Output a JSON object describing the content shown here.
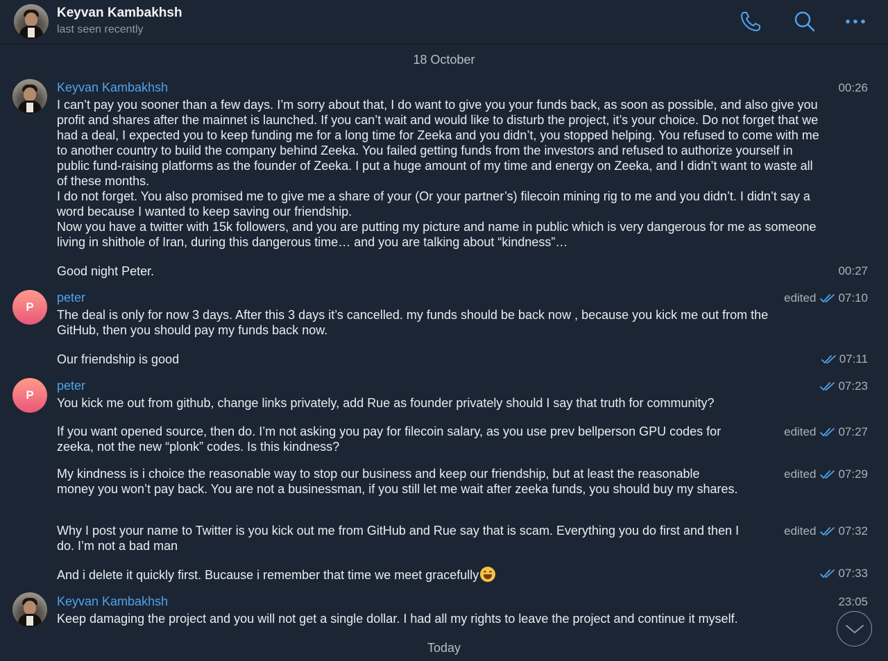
{
  "header": {
    "title": "Keyvan Kambakhsh",
    "subtitle": "last seen recently",
    "icons": [
      "phone-icon",
      "search-icon",
      "more-icon"
    ]
  },
  "colors": {
    "background": "#1c2533",
    "accent": "#4ea4f0",
    "text": "#e9edf2",
    "meta": "#a7b2be"
  },
  "dates": {
    "first": "18 October",
    "today": "Today"
  },
  "messages": [
    {
      "sender": "Keyvan Kambakhsh",
      "time": "00:26",
      "paragraphs": [
        "I can’t pay you sooner than a few days. I’m sorry about that, I do want to give you your funds back, as soon as possible, and also give you profit and shares after the mainnet is launched. If you can’t wait and would like to disturb the project, it’s your choice. Do not forget that we had a deal, I expected you to keep funding me for a long time for Zeeka and you didn’t, you stopped helping. You refused to come with me to another country to build the company behind Zeeka. You failed getting funds from the investors and refused to authorize yourself in public fund-raising platforms as the founder of Zeeka. I put a huge amount of my time and energy on Zeeka, and I didn’t want to waste all of these months.",
        "I do not forget. You also promised me to give me a share of your (Or your partner’s) filecoin mining rig to me and you didn’t. I didn’t say a word because I wanted to keep saving our friendship.",
        "Now you have a twitter with 15k followers, and you are putting my picture and name in public which is very dangerous for me as someone living in shithole of Iran, during this dangerous time… and you are talking about “kindness”…"
      ]
    },
    {
      "text": "Good night Peter.",
      "time": "00:27"
    },
    {
      "sender": "peter",
      "avatar_letter": "P",
      "edited": "edited",
      "time": "07:10",
      "text": "The deal is only for now 3 days.  After this 3 days it’s cancelled. my funds should be back now , because you kick me out from the GitHub, then you should pay my funds back now."
    },
    {
      "text": "Our friendship is good",
      "time": "07:11"
    },
    {
      "sender": "peter",
      "avatar_letter": "P",
      "time": "07:23",
      "text": "You kick me out from github, change links privately, add Rue as founder  privately should I say that truth for community?"
    },
    {
      "edited": "edited",
      "time": "07:27",
      "text": "If you want opened source, then do. I’m not asking you pay for filecoin salary, as you use prev bellperson GPU codes for zeeka, not the new “plonk” codes. Is this kindness?"
    },
    {
      "edited": "edited",
      "time": "07:29",
      "text": "My kindness is i choice the reasonable way to stop our business and keep our friendship, but at least the reasonable money you won’t pay back. You are not a businessman, if you still let me wait after zeeka funds, you should buy my shares."
    },
    {
      "edited": "edited",
      "time": "07:32",
      "text": "Why I post your name to Twitter is you kick out me from GitHub and Rue say that is scam. Everything you do first and then I do. I’m not a bad man"
    },
    {
      "time": "07:33",
      "text": "And i delete it quickly first. Bucause i remember that time we meet gracefully",
      "emoji": "grinning-face-emoji"
    },
    {
      "sender": "Keyvan Kambakhsh",
      "time": "23:05",
      "text": "Keep damaging the project and you will not get a single dollar. I had all my rights to leave the project and continue it myself."
    }
  ]
}
